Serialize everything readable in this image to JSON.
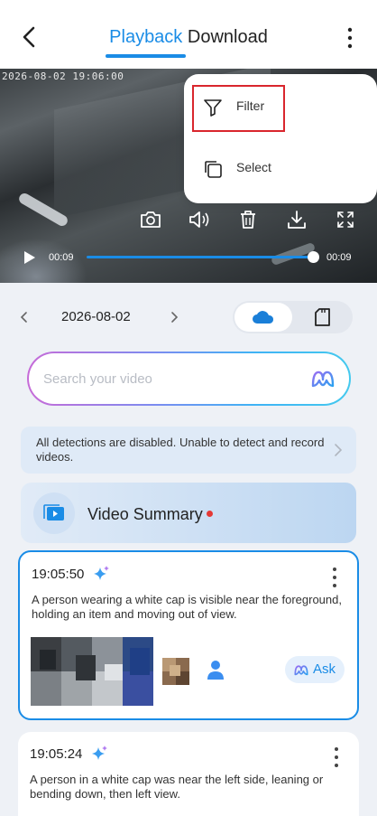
{
  "header": {
    "tab_active": "Playback",
    "tab_inactive": "Download"
  },
  "video": {
    "timestamp": "2026-08-02  19:06:00",
    "elapsed": "00:09",
    "duration": "00:09",
    "progress": 1.0,
    "tools": [
      "camera-icon",
      "speaker-icon",
      "trash-icon",
      "download-icon",
      "fullscreen-icon"
    ]
  },
  "menu": {
    "items": [
      {
        "label": "Filter",
        "icon": "filter-icon"
      },
      {
        "label": "Select",
        "icon": "select-icon"
      }
    ]
  },
  "datebar": {
    "date": "2026-08-02",
    "storage_options": [
      "cloud-icon",
      "sd-card-icon"
    ],
    "selected": "cloud"
  },
  "search": {
    "placeholder": "Search your video",
    "value": ""
  },
  "notice": {
    "text": "All detections are disabled. Unable to detect and record videos."
  },
  "summary": {
    "label": "Video Summary"
  },
  "events": [
    {
      "time": "19:05:50",
      "description": "A person wearing a white cap is visible near the foreground, holding an item and moving out of view.",
      "ask_label": "Ask"
    },
    {
      "time": "19:05:24",
      "description": "A person in a white cap was near the left side, leaning or bending down, then left view."
    }
  ],
  "colors": {
    "accent": "#1a8ce6",
    "highlight_box": "#d9262d",
    "notification_dot": "#e53935"
  }
}
